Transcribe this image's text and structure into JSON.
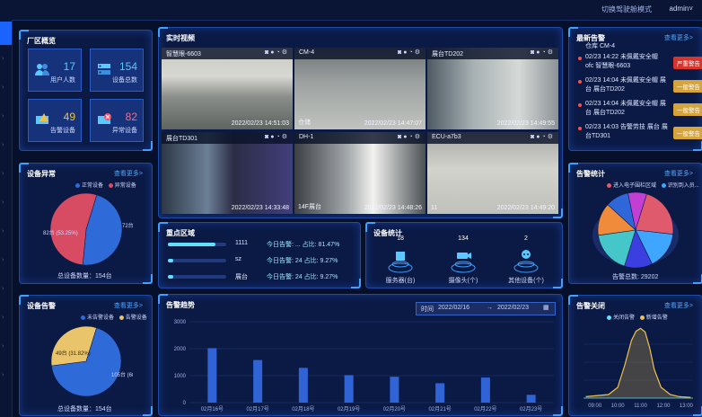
{
  "topbar": {
    "mode": "切换驾驶舱模式",
    "user": "admin"
  },
  "area": {
    "title": "厂区概览",
    "tiles": [
      {
        "value": "17",
        "label": "用户人数",
        "icon": "users-icon"
      },
      {
        "value": "154",
        "label": "设备总数",
        "icon": "server-icon"
      },
      {
        "value": "49",
        "label": "告警设备",
        "icon": "alarm-device-icon"
      },
      {
        "value": "82",
        "label": "异常设备",
        "icon": "error-device-icon"
      }
    ]
  },
  "anomaly": {
    "title": "设备异常",
    "more": "查看更多>",
    "legend": [
      "正常设备",
      "异常设备"
    ],
    "footer": "总设备数量：154台"
  },
  "alarmdev": {
    "title": "设备告警",
    "more": "查看更多>",
    "legend": [
      "未告警设备",
      "告警设备"
    ],
    "footer": "总设备数量：154台"
  },
  "video": {
    "title": "实时视频",
    "cams": [
      {
        "name": "智慧眼-6603",
        "ts": "2022/02/23 14:51:03",
        "bl": ""
      },
      {
        "name": "CM-4",
        "ts": "2022/02/23 14:47:07",
        "bl": "仓储"
      },
      {
        "name": "展台TD202",
        "ts": "2022/02/23 14:49:55",
        "bl": ""
      },
      {
        "name": "展台TD301",
        "ts": "2022/02/23 14:33:48",
        "bl": ""
      },
      {
        "name": "DH-1",
        "ts": "2022/02/23 14:48:26",
        "bl": "14F展台"
      },
      {
        "name": "ECU-a7b3",
        "ts": "2022/02/23 14:49:20",
        "bl": "11"
      }
    ]
  },
  "focus": {
    "title": "重点区域",
    "rows": [
      {
        "name": "1111",
        "text": "今日告警: ... 占比: 81.47%",
        "pct": 0.8147
      },
      {
        "name": "sz",
        "text": "今日告警: 24 占比: 9.27%",
        "pct": 0.0927
      },
      {
        "name": "展台",
        "text": "今日告警: 24 占比: 9.27%",
        "pct": 0.0927
      }
    ]
  },
  "devstat": {
    "title": "设备统计",
    "items": [
      {
        "value": "18",
        "label": "服务器(台)",
        "icon": "server-icon"
      },
      {
        "value": "134",
        "label": "摄像头(个)",
        "icon": "camera-icon"
      },
      {
        "value": "2",
        "label": "其他设备(个)",
        "icon": "robot-icon"
      }
    ]
  },
  "trend": {
    "title": "告警趋势",
    "time_label": "时间",
    "date_from": "2022/02/16",
    "date_to": "2022/02/23",
    "arrow": "→"
  },
  "latest": {
    "title": "最新告警",
    "more": "查看更多>",
    "top_line": "仓库 CM-4",
    "items": [
      {
        "time": "02/23 14:22",
        "text": "未佩戴安全帽 ofc 智慧眼-6603",
        "badge": "严重警告",
        "color": "#d8342c"
      },
      {
        "time": "02/23 14:04",
        "text": "未佩戴安全帽 展台 展台TD202",
        "badge": "一般警告",
        "color": "#d6a43a"
      },
      {
        "time": "02/23 14:04",
        "text": "未佩戴安全帽 展台 展台TD202",
        "badge": "一般警告",
        "color": "#d6a43a"
      },
      {
        "time": "02/23 14:03",
        "text": "告警劳技 展台 展台TD301",
        "badge": "一般警告",
        "color": "#d6a43a"
      }
    ]
  },
  "astat": {
    "title": "告警统计",
    "more": "查看更多>",
    "legend": [
      "进入电子围栏区域",
      "识别到入员..."
    ],
    "footer": "告警总数: 29202"
  },
  "aclose": {
    "title": "告警关闭",
    "more": "查看更多>",
    "legend": [
      "关闭告警",
      "新增告警"
    ]
  },
  "chart_data": [
    {
      "type": "pie",
      "title": "设备异常",
      "labels": [
        "正常设备",
        "异常设备"
      ],
      "values": [
        72,
        82
      ],
      "annotations": [
        "72台 (46.75%)",
        "82台 (53.25%)"
      ],
      "colors": [
        "#2f6bd8",
        "#d84c63"
      ]
    },
    {
      "type": "pie",
      "title": "设备告警",
      "labels": [
        "未告警设备",
        "告警设备"
      ],
      "values": [
        105,
        49
      ],
      "annotations": [
        "105台 (68.18%)",
        "49台 (31.82%)"
      ],
      "colors": [
        "#2f6bd8",
        "#e9c46a"
      ]
    },
    {
      "type": "bar",
      "title": "告警趋势",
      "categories": [
        "02月16号",
        "02月17号",
        "02月18号",
        "02月19号",
        "02月20号",
        "02月21号",
        "02月22号",
        "02月23号"
      ],
      "values": [
        2020,
        1580,
        1290,
        1020,
        960,
        720,
        930,
        290
      ],
      "ylim": [
        0,
        3000
      ],
      "yticks": [
        0,
        1000,
        2000,
        3000
      ]
    },
    {
      "type": "pie",
      "title": "告警统计",
      "values": [
        22,
        16,
        12,
        18,
        14,
        10,
        8
      ],
      "colors": [
        "#e05a6d",
        "#3ea6ff",
        "#3b3fe0",
        "#45c6c8",
        "#ef8b3a",
        "#2f66d8",
        "#c33fd4"
      ]
    },
    {
      "type": "area",
      "title": "告警关闭",
      "series": [
        {
          "name": "新增告警",
          "color": "#f0c24a"
        },
        {
          "name": "关闭告警",
          "color": "#5fe0ff"
        }
      ],
      "x_ticks": [
        "09:00",
        "10:00",
        "11:00",
        "12:00",
        "13:00"
      ],
      "x": [
        8.6,
        9.6,
        10.0,
        10.3,
        10.6,
        10.8,
        11.0,
        11.2,
        11.4,
        11.6,
        11.9,
        12.3,
        12.7,
        13.2
      ],
      "values": [
        0.02,
        0.05,
        0.15,
        0.45,
        0.8,
        0.93,
        0.97,
        0.92,
        0.7,
        0.4,
        0.15,
        0.05,
        0.02,
        0.01
      ],
      "ylim": [
        0,
        1
      ]
    }
  ]
}
